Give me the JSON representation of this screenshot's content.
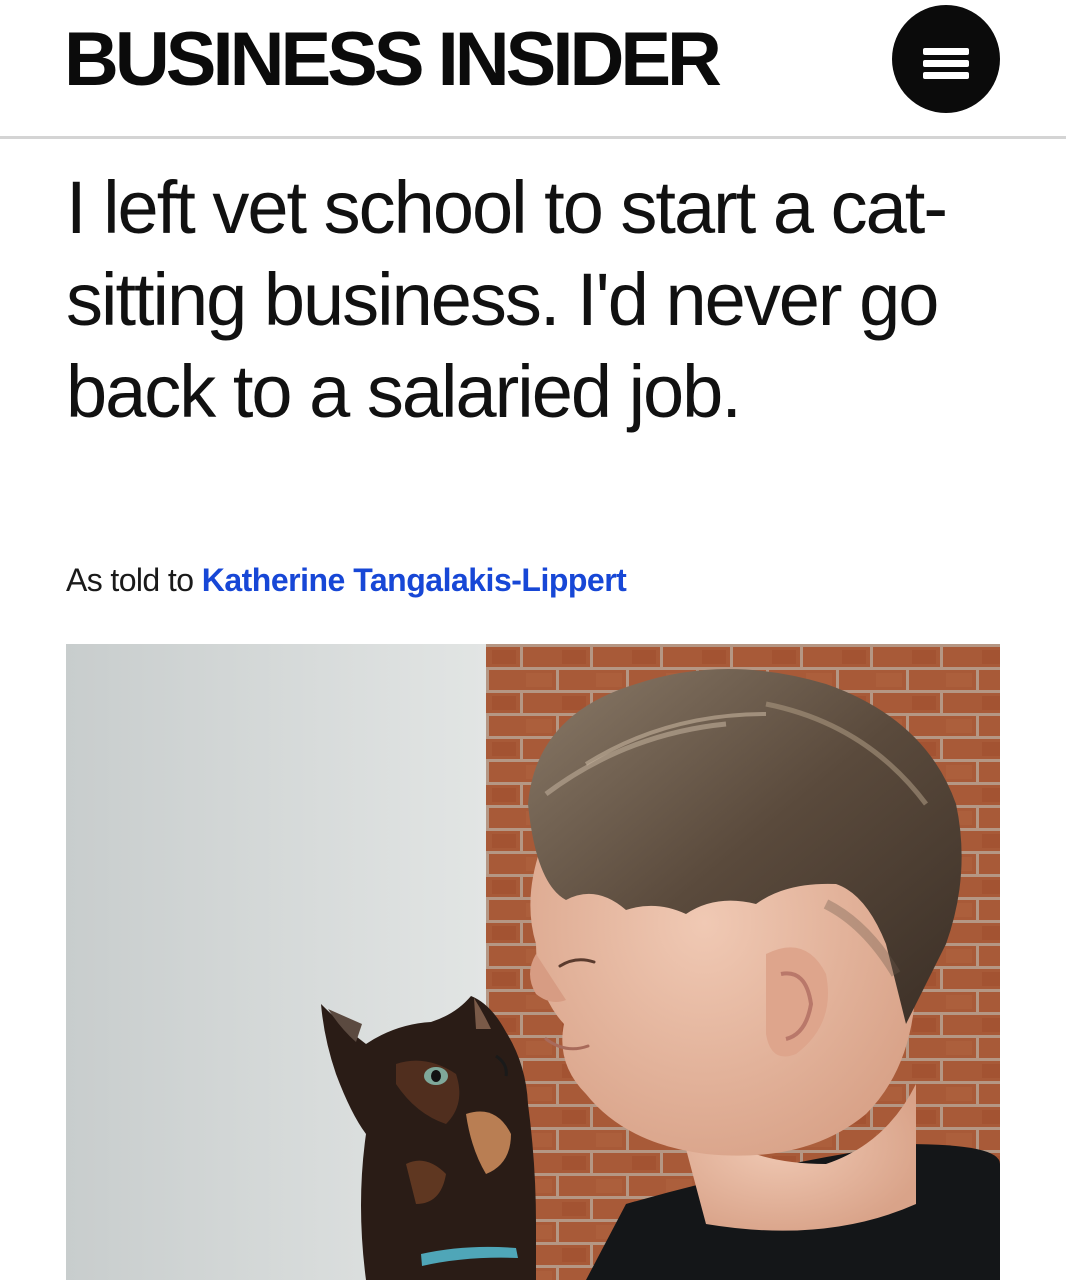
{
  "header": {
    "brand": "BUSINESS INSIDER",
    "menu_icon": "hamburger-menu-icon"
  },
  "article": {
    "headline": "I left vet school to start a cat-sitting business. I'd never go back to a salaried job.",
    "byline_prefix": "As told to",
    "author": "Katherine Tangalakis-Lippert"
  },
  "colors": {
    "brand_text": "#0b0b0b",
    "author_link": "#1747d6",
    "divider": "#d4d4d4"
  }
}
